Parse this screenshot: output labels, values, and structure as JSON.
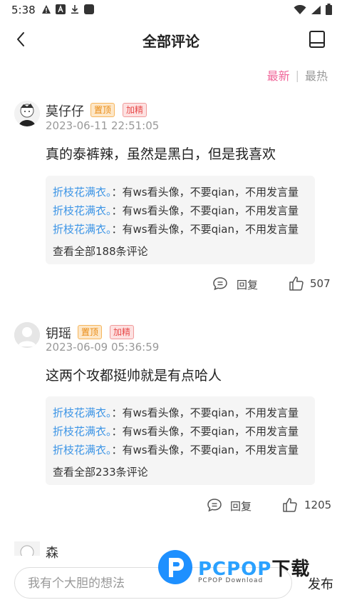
{
  "status": {
    "time": "5:38"
  },
  "nav": {
    "title": "全部评论"
  },
  "sort": {
    "newest": "最新",
    "separator": "|",
    "hottest": "最热",
    "active_color": "#f0679a"
  },
  "comments": [
    {
      "username": "莫仔仔",
      "badge_top": "置顶",
      "badge_jing": "加精",
      "time": "2023-06-11 22:51:05",
      "text": "真的泰裤辣，虽然是黑白，但是我喜欢",
      "replies": [
        {
          "name": "折枝花满衣。",
          "text": "：有ws看头像，不要qian，不用发言量"
        },
        {
          "name": "折枝花满衣。",
          "text": "：有ws看头像，不要qian，不用发言量"
        },
        {
          "name": "折枝花满衣。",
          "text": "：有ws看头像，不要qian，不用发言量"
        }
      ],
      "view_all": "查看全部188条评论",
      "reply_label": "回复",
      "likes": "507"
    },
    {
      "username": "钥瑶",
      "badge_top": "置顶",
      "badge_jing": "加精",
      "time": "2023-06-09 05:36:59",
      "text": "这两个攻都挺帅就是有点哈人",
      "replies": [
        {
          "name": "折枝花满衣。",
          "text": "：有ws看头像，不要qian，不用发言量"
        },
        {
          "name": "折枝花满衣。",
          "text": "：有ws看头像，不要qian，不用发言量"
        },
        {
          "name": "折枝花满衣。",
          "text": "：有ws看头像，不要qian，不用发言量"
        }
      ],
      "view_all": "查看全部233条评论",
      "reply_label": "回复",
      "likes": "1205"
    }
  ],
  "partial_comment": {
    "username": "森"
  },
  "bottom": {
    "placeholder": "我有个大胆的想法",
    "send": "发布"
  },
  "watermark": {
    "brand": "PCPOP",
    "suffix": "下载",
    "sub": "PCPOP Download"
  }
}
